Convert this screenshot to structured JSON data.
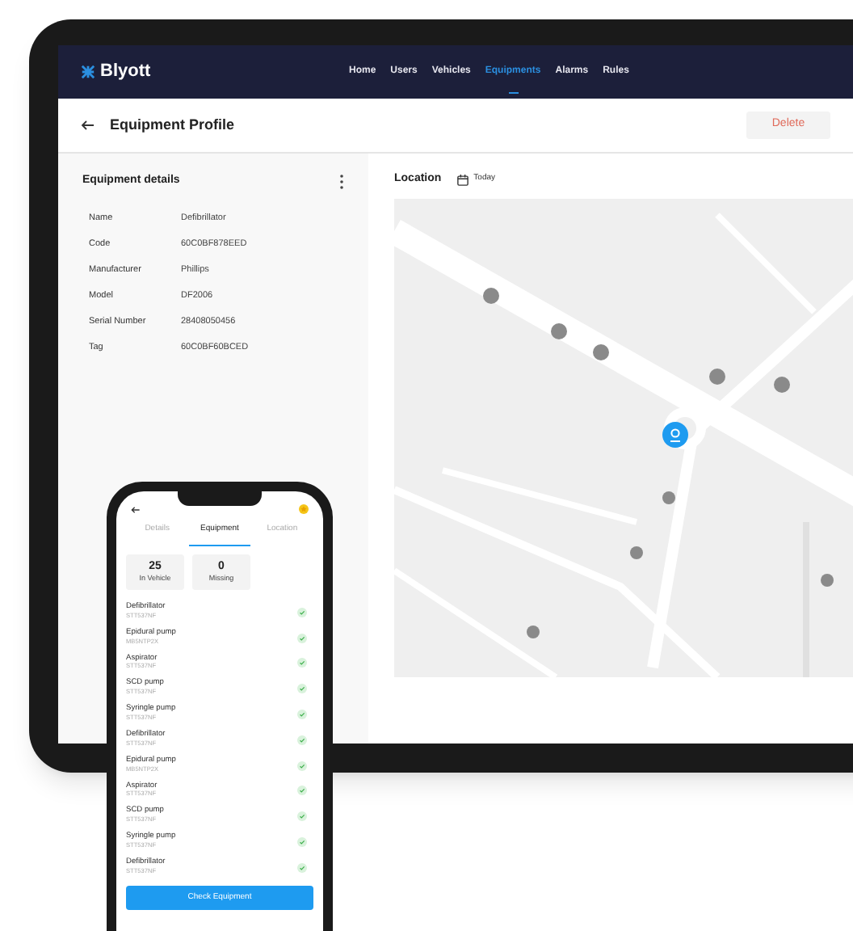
{
  "app": {
    "logo": "Blyott",
    "nav": [
      {
        "label": "Home",
        "selected": false
      },
      {
        "label": "Users",
        "selected": false
      },
      {
        "label": "Vehicles",
        "selected": false
      },
      {
        "label": "Equipments",
        "selected": true
      },
      {
        "label": "Alarms",
        "selected": false
      },
      {
        "label": "Rules",
        "selected": false
      }
    ]
  },
  "header": {
    "title": "Equipment Profile",
    "delete_button": "Delete"
  },
  "details": {
    "title": "Equipment details",
    "fields": [
      {
        "label": "Name",
        "value": "Defibrillator"
      },
      {
        "label": "Code",
        "value": "60C0BF878EED"
      },
      {
        "label": "Manufacturer",
        "value": "Phillips"
      },
      {
        "label": "Model",
        "value": "DF2006"
      },
      {
        "label": "Serial Number",
        "value": "28408050456"
      },
      {
        "label": "Tag",
        "value": "60C0BF60BCED"
      }
    ]
  },
  "location": {
    "title": "Location",
    "date": "Today"
  },
  "phone": {
    "tabs": [
      {
        "label": "Details",
        "selected": false
      },
      {
        "label": "Equipment",
        "selected": true
      },
      {
        "label": "Location",
        "selected": false
      }
    ],
    "stats": [
      {
        "value": "25",
        "label": "In Vehicle"
      },
      {
        "value": "0",
        "label": "Missing"
      }
    ],
    "items": [
      {
        "name": "Defibrillator",
        "code": "STT537NF",
        "checked": true
      },
      {
        "name": "Epidural pump",
        "code": "MB5NTP2X",
        "checked": true
      },
      {
        "name": "Aspirator",
        "code": "STT537NF",
        "checked": true
      },
      {
        "name": "SCD pump",
        "code": "STT537NF",
        "checked": true
      },
      {
        "name": "Syringle pump",
        "code": "STT537NF",
        "checked": true
      },
      {
        "name": "Defibrillator",
        "code": "STT537NF",
        "checked": true
      },
      {
        "name": "Epidural pump",
        "code": "MB5NTP2X",
        "checked": true
      },
      {
        "name": "Aspirator",
        "code": "STT537NF",
        "checked": true
      },
      {
        "name": "SCD pump",
        "code": "STT537NF",
        "checked": true
      },
      {
        "name": "Syringle pump",
        "code": "STT537NF",
        "checked": true
      },
      {
        "name": "Defibrillator",
        "code": "STT537NF",
        "checked": true
      }
    ],
    "button": "Check Equipment"
  }
}
